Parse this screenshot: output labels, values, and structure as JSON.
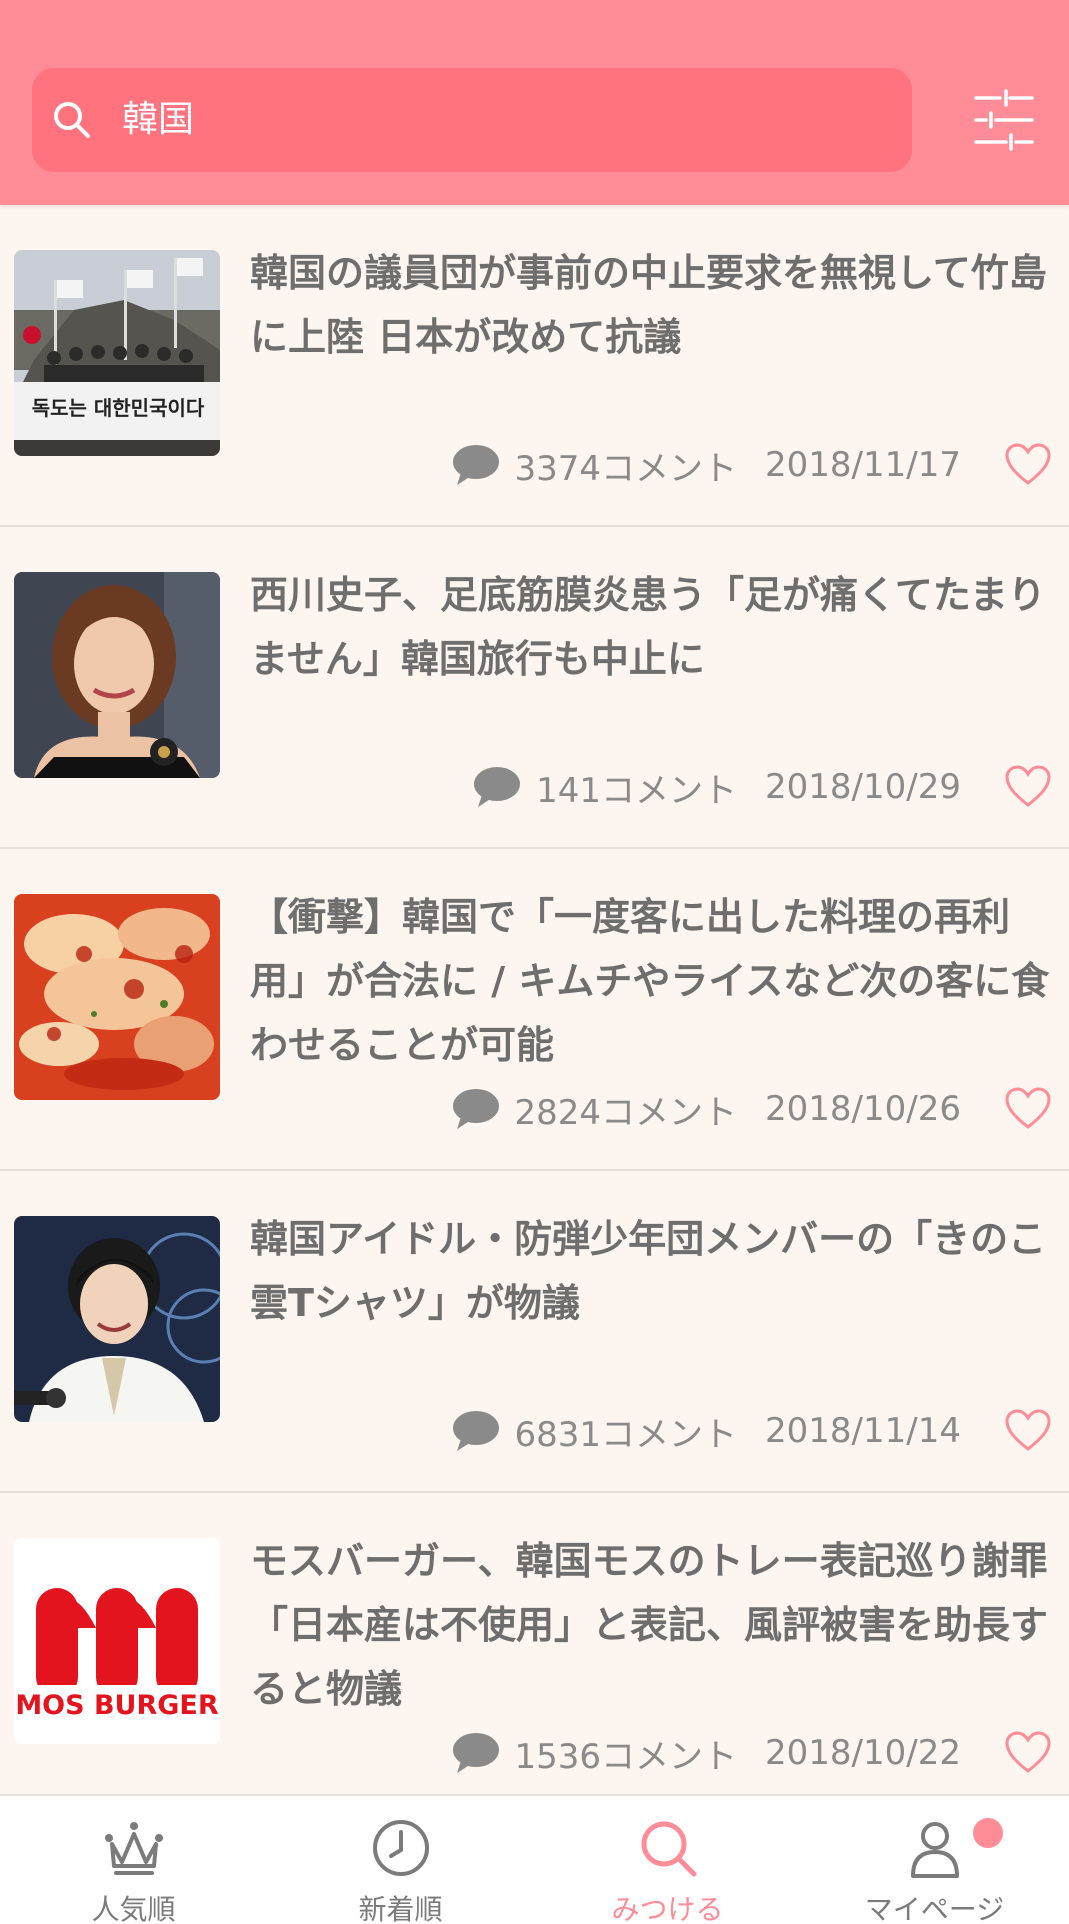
{
  "search": {
    "query": "韓国"
  },
  "colors": {
    "header": "#ff8c97",
    "search_box": "#ff737f",
    "accent": "#ff8c97",
    "background": "#fdf5ef"
  },
  "articles": [
    {
      "title": "韓国の議員団が事前の中止要求を無視して竹島に上陸 日本が改めて抗議",
      "comments": "3374コメント",
      "date": "2018/11/17"
    },
    {
      "title": "西川史子、足底筋膜炎患う「足が痛くてたまりません」韓国旅行も中止に",
      "comments": "141コメント",
      "date": "2018/10/29"
    },
    {
      "title": "【衝撃】韓国で「一度客に出した料理の再利用」が合法に / キムチやライスなど次の客に食わせることが可能",
      "comments": "2824コメント",
      "date": "2018/10/26"
    },
    {
      "title": "韓国アイドル・防弾少年団メンバーの「きのこ雲Tシャツ」が物議",
      "comments": "6831コメント",
      "date": "2018/11/14"
    },
    {
      "title": "モスバーガー、韓国モスのトレー表記巡り謝罪　「日本産は不使用」と表記、風評被害を助長すると物議",
      "comments": "1536コメント",
      "date": "2018/10/22"
    }
  ],
  "thumb_text": {
    "protest_banner": "독도는 대한민국이다",
    "mos_logo": "MOS BURGER"
  },
  "nav": [
    {
      "label": "人気順",
      "icon": "crown-icon"
    },
    {
      "label": "新着順",
      "icon": "clock-icon"
    },
    {
      "label": "みつける",
      "icon": "search-icon"
    },
    {
      "label": "マイページ",
      "icon": "person-icon"
    }
  ]
}
